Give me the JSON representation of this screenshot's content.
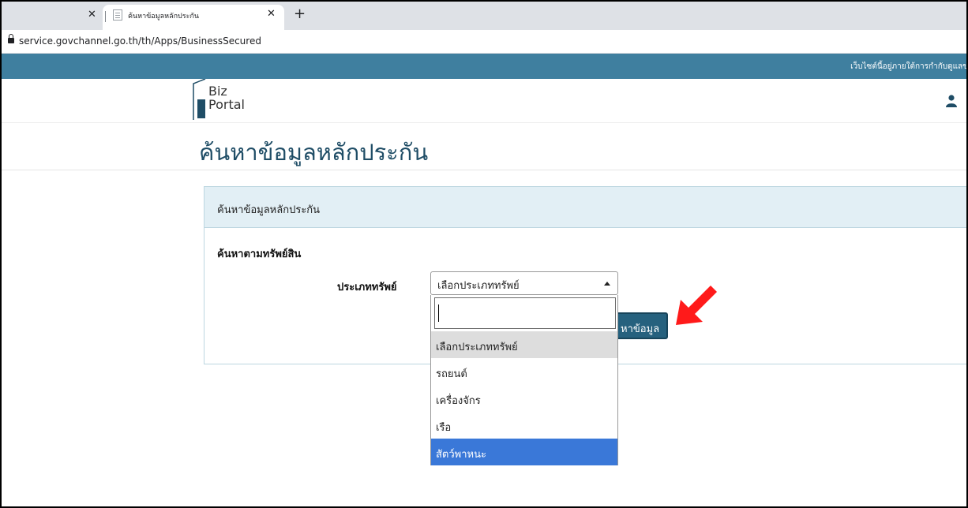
{
  "browser": {
    "tab_title": "ค้นหาข้อมูลหลักประกัน",
    "url": "service.govchannel.go.th/th/Apps/BusinessSecured"
  },
  "site": {
    "banner_text": "เว็บไซต์นี้อยู่ภายใต้การกำกับดูแลข",
    "logo_line1": "Biz",
    "logo_line2": "Portal"
  },
  "page": {
    "title": "ค้นหาข้อมูลหลักประกัน"
  },
  "panel": {
    "heading": "ค้นหาข้อมูลหลักประกัน",
    "section_label": "ค้นหาตามทรัพย์สิน",
    "field_label": "ประเภททรัพย์",
    "select_value": "เลือกประเภททรัพย์",
    "search_button_label": "หาข้อมูล",
    "options": [
      "เลือกประเภททรัพย์",
      "รถยนต์",
      "เครื่องจักร",
      "เรือ",
      "สัตว์พาหนะ"
    ]
  },
  "colors": {
    "banner": "#3f7f9f",
    "title": "#1f4d66",
    "panel_heading": "#e2eff5",
    "button": "#26617e",
    "option_selected": "#3a78d8",
    "annotation_arrow": "#ff1a1a"
  }
}
